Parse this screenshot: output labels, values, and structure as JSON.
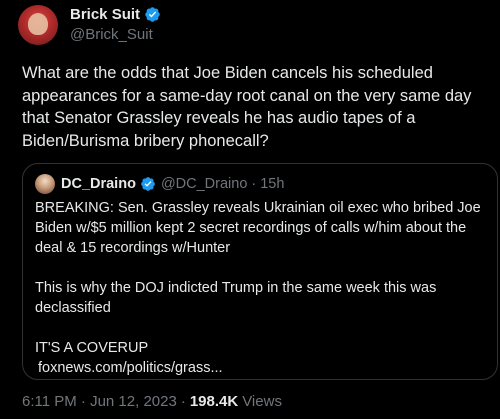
{
  "author": {
    "display_name": "Brick Suit",
    "handle": "@Brick_Suit",
    "verified": true
  },
  "tweet": {
    "text": "What are the odds that Joe Biden cancels his scheduled\nappearances for a same-day root canal on the very same day\nthat Senator Grassley reveals he has audio tapes of a\nBiden/Burisma bribery phonecall?"
  },
  "quoted": {
    "display_name": "DC_Draino",
    "handle": "@DC_Draino",
    "separator": "·",
    "time": "15h",
    "verified": true,
    "text": "BREAKING: Sen. Grassley reveals Ukrainian oil exec who bribed Joe\nBiden w/$5 million kept 2 secret recordings of calls w/him about the\ndeal & 15 recordings w/Hunter\n\nThis is why the DOJ indicted Trump in the same week this was\ndeclassified\n\nIT'S A COVERUP",
    "link": "foxnews.com/politics/grass..."
  },
  "footer": {
    "timestamp": "6:11 PM · Jun 12, 2023",
    "dot": "·",
    "views_count": "198.4K",
    "views_label": "Views"
  },
  "colors": {
    "background": "#000000",
    "text": "#e7e9ea",
    "muted": "#71767b",
    "verified_blue": "#1d9bf0",
    "border": "#2f3336"
  }
}
